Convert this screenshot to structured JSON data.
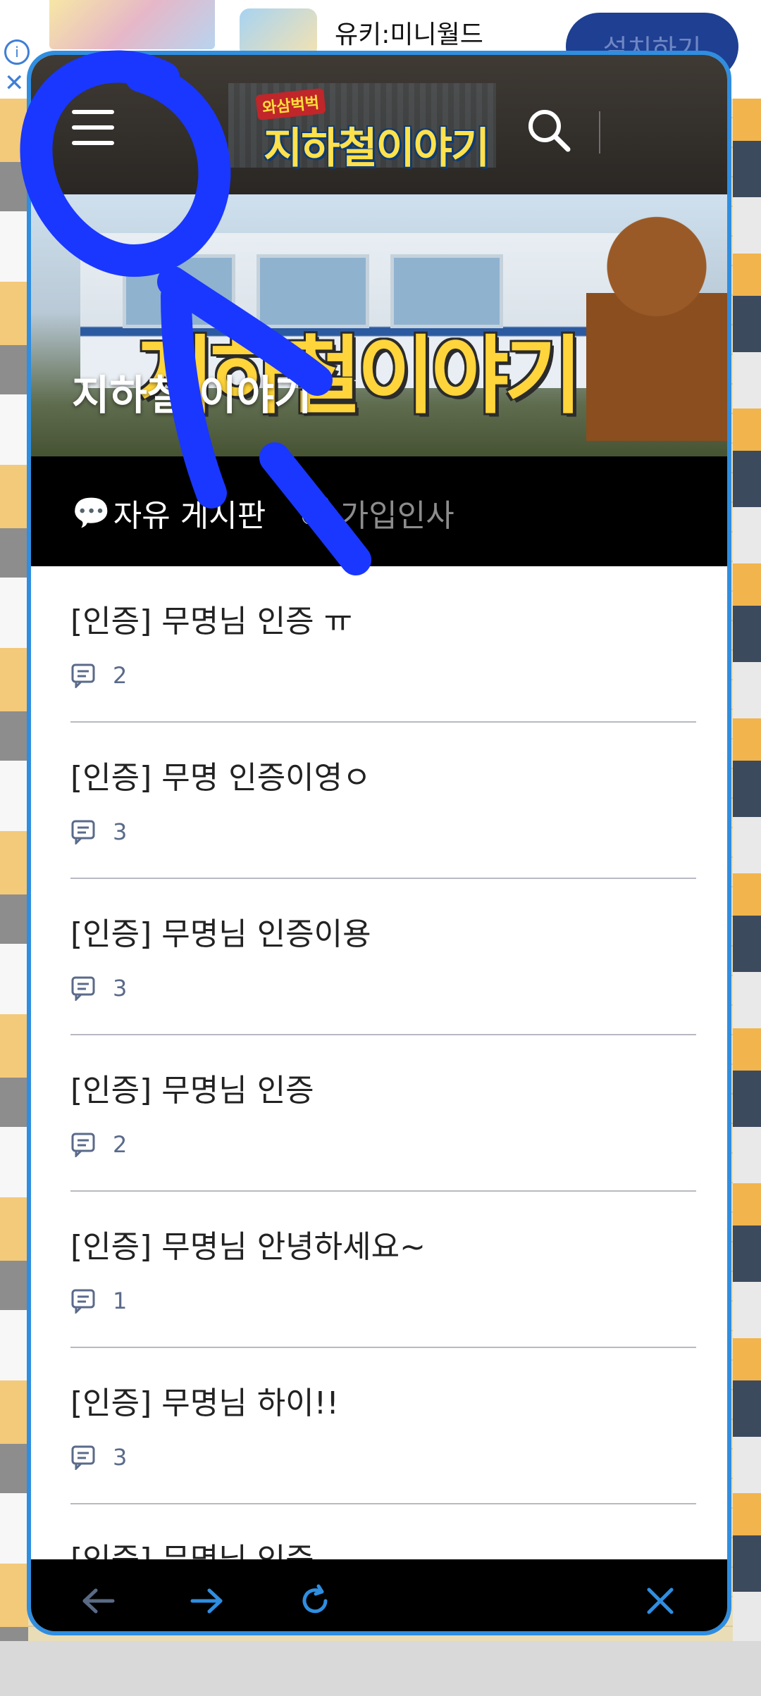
{
  "ad": {
    "title": "유키:미니월드",
    "install_label": "설치하기",
    "info_icon": "info-icon",
    "close_icon": "close-icon"
  },
  "header": {
    "logo_sub": "와삼벅벅",
    "logo_main": "지하철이야기",
    "menu_icon": "hamburger-menu-icon",
    "search_icon": "search-icon"
  },
  "banner": {
    "big_title": "지하철이야기",
    "cafe_name": "지하철 이야기"
  },
  "tabs": [
    {
      "emoji": "💬",
      "label": "자유 게시판",
      "active": true
    },
    {
      "emoji": "👋",
      "label": "가입인사",
      "active": false
    }
  ],
  "posts": [
    {
      "title": "[인증] 무명님 인증 ㅠ",
      "comments": "2"
    },
    {
      "title": "[인증] 무명 인증이영ㅇ",
      "comments": "3"
    },
    {
      "title": "[인증] 무명님 인증이용",
      "comments": "3"
    },
    {
      "title": "[인증] 무명님 인증",
      "comments": "2"
    },
    {
      "title": "[인증] 무명님 안녕하세요~",
      "comments": "1"
    },
    {
      "title": "[인증] 무명님 하이!!",
      "comments": "3"
    },
    {
      "title": "[인증] 무명님 인증",
      "comments": ""
    }
  ],
  "bottom_nav": {
    "back_icon": "arrow-left-icon",
    "forward_icon": "arrow-right-icon",
    "refresh_icon": "refresh-icon",
    "close_icon": "close-icon"
  },
  "colors": {
    "frame_border": "#2f8ee0",
    "nav_active": "#2f8ee0",
    "nav_disabled": "#5a6a85",
    "annotation": "#1a37ff",
    "tab_bar": "#000000"
  }
}
